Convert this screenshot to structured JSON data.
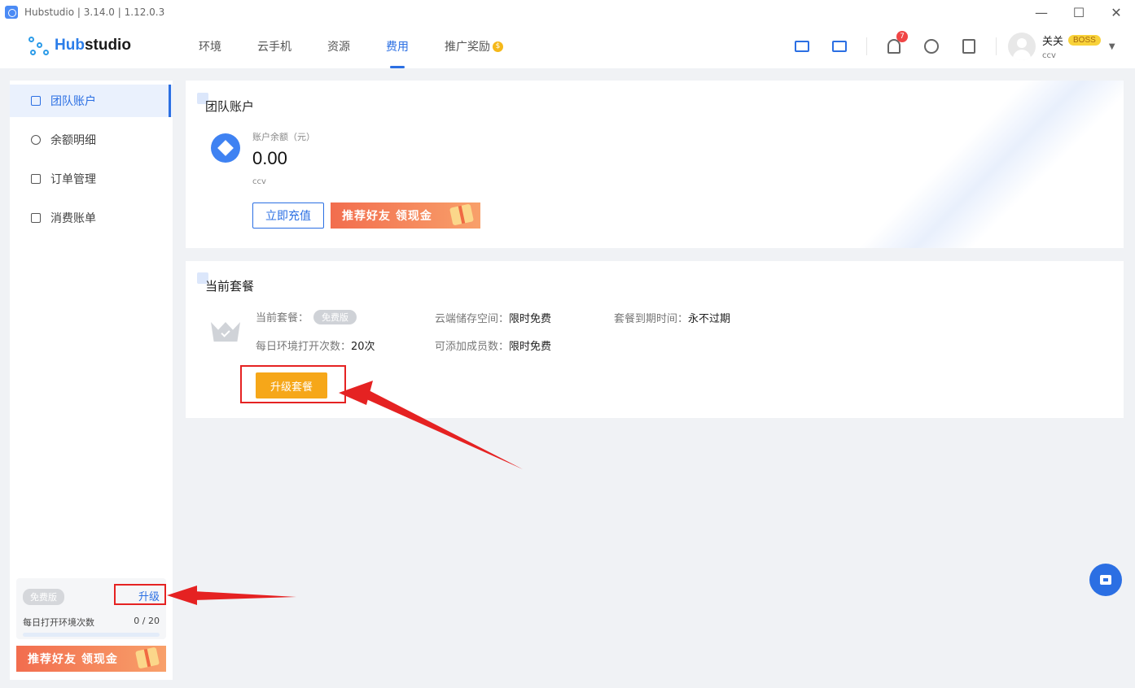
{
  "window": {
    "title": "Hubstudio | 3.14.0 | 1.12.0.3",
    "minimize": "—",
    "maximize": "☐",
    "close": "✕"
  },
  "header": {
    "logo_prefix": "Hub",
    "logo_suffix": "studio",
    "nav": [
      {
        "label": "环境"
      },
      {
        "label": "云手机"
      },
      {
        "label": "资源"
      },
      {
        "label": "费用",
        "active": true
      },
      {
        "label": "推广奖励"
      }
    ],
    "notification_count": "7",
    "user": {
      "name": "关关",
      "role_badge": "BOSS",
      "team": "ccv"
    }
  },
  "sidebar": {
    "items": [
      {
        "label": "团队账户",
        "icon": "wallet-icon",
        "active": true
      },
      {
        "label": "余额明细",
        "icon": "yen-icon"
      },
      {
        "label": "订单管理",
        "icon": "clipboard-icon"
      },
      {
        "label": "消费账单",
        "icon": "bill-icon"
      }
    ],
    "plan": {
      "tag": "免费版",
      "upgrade_label": "升级",
      "opens_label": "每日打开环境次数",
      "opens_count": "0 / 20",
      "opens_fraction": 0
    },
    "promo_label": "推荐好友 领现金"
  },
  "account_card": {
    "title": "团队账户",
    "balance_label": "账户余额（元）",
    "balance_value": "0.00",
    "team_name": "ccv",
    "recharge_button": "立即充值",
    "promo_label": "推荐好友 领现金"
  },
  "plan_card": {
    "title": "当前套餐",
    "current_plan_label": "当前套餐：",
    "current_plan_value": "免费版",
    "daily_opens_label": "每日环境打开次数：",
    "daily_opens_value": "20次",
    "cloud_storage_label": "云端储存空间：",
    "cloud_storage_value": "限时免费",
    "members_label": "可添加成员数：",
    "members_value": "限时免费",
    "expiry_label": "套餐到期时间：",
    "expiry_value": "永不过期",
    "upgrade_button": "升级套餐"
  },
  "colors": {
    "accent": "#2b6fe3",
    "upgrade": "#f6a719",
    "annotation": "#e52222",
    "badge": "#f04545",
    "promo_start": "#f26d4e"
  }
}
